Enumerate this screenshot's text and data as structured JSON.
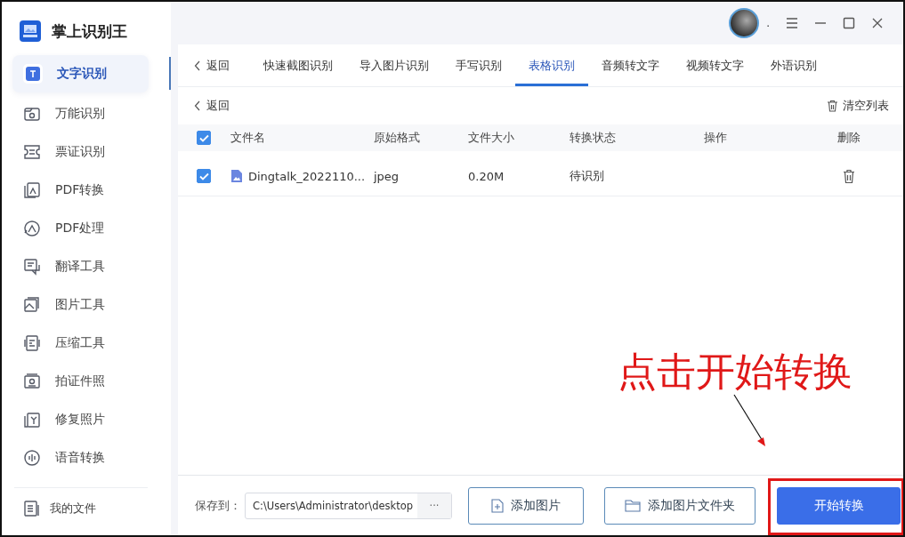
{
  "app": {
    "title": "掌上识别王"
  },
  "window_controls": {
    "user_name": "."
  },
  "sidebar": {
    "items": [
      {
        "label": "文字识别",
        "selected": true
      },
      {
        "label": "万能识别",
        "selected": false
      },
      {
        "label": "票证识别",
        "selected": false
      },
      {
        "label": "PDF转换",
        "selected": false
      },
      {
        "label": "PDF处理",
        "selected": false
      },
      {
        "label": "翻译工具",
        "selected": false
      },
      {
        "label": "图片工具",
        "selected": false
      },
      {
        "label": "压缩工具",
        "selected": false
      },
      {
        "label": "拍证件照",
        "selected": false
      },
      {
        "label": "修复照片",
        "selected": false
      },
      {
        "label": "语音转换",
        "selected": false
      }
    ],
    "footer_item": {
      "label": "我的文件"
    }
  },
  "tabs": {
    "back": "返回",
    "items": [
      {
        "label": "快速截图识别",
        "selected": false
      },
      {
        "label": "导入图片识别",
        "selected": false
      },
      {
        "label": "手写识别",
        "selected": false
      },
      {
        "label": "表格识别",
        "selected": true
      },
      {
        "label": "音频转文字",
        "selected": false
      },
      {
        "label": "视频转文字",
        "selected": false
      },
      {
        "label": "外语识别",
        "selected": false
      }
    ]
  },
  "toolbar": {
    "back": "返回",
    "clear": "清空列表"
  },
  "table": {
    "all_checked": true,
    "columns": [
      "文件名",
      "原始格式",
      "文件大小",
      "转换状态",
      "操作",
      "删除"
    ],
    "rows": [
      {
        "checked": true,
        "name": "Dingtalk_2022110...",
        "format": "jpeg",
        "size": "0.20M",
        "status": "待识别"
      }
    ]
  },
  "bottom": {
    "save_label": "保存到：",
    "path": "C:\\Users\\Administrator\\desktop",
    "browse": "···",
    "add_image": "添加图片",
    "add_folder": "添加图片文件夹",
    "start": "开始转换"
  },
  "annotation": {
    "text": "点击开始转换"
  }
}
